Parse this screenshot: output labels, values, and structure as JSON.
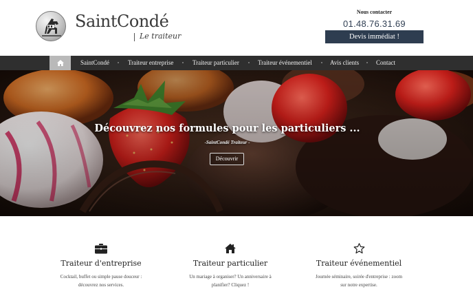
{
  "header": {
    "brand_name": "SaintCondé",
    "brand_tagline": "Le traiteur",
    "contact_label": "Nous contacter",
    "phone": "01.48.76.31.69",
    "quote_button": "Devis immédiat !"
  },
  "nav": {
    "home_icon": "home-icon",
    "items": [
      {
        "label": "SaintCondé"
      },
      {
        "label": "Traiteur entreprise"
      },
      {
        "label": "Traiteur particulier"
      },
      {
        "label": "Traiteur événementiel"
      },
      {
        "label": "Avis clients"
      },
      {
        "label": "Contact"
      }
    ]
  },
  "hero": {
    "title": "Découvrez nos formules pour les particuliers ...",
    "subtitle": "-SaintCondé Traiteur -",
    "button": "Découvrir"
  },
  "services": [
    {
      "icon": "briefcase-icon",
      "title": "Traiteur d'entreprise",
      "desc_line1": "Cocktail, buffet ou simple pause douceur :",
      "desc_line2": "découvrez nos services."
    },
    {
      "icon": "home-icon",
      "title": "Traiteur particulier",
      "desc_line1": "Un mariage à organiser? Un anniversaire à",
      "desc_line2": "planifier? Cliquez !"
    },
    {
      "icon": "star-outline-icon",
      "title": "Traiteur événementiel",
      "desc_line1": "Journée séminaire, soirée d'entreprise : zoom",
      "desc_line2": "sur notre expertise."
    }
  ],
  "colors": {
    "nav_bg": "#2f2f2f",
    "nav_home_bg": "#b9b9b9",
    "button_bg": "#2e3d50",
    "phone": "#2f3e52"
  }
}
